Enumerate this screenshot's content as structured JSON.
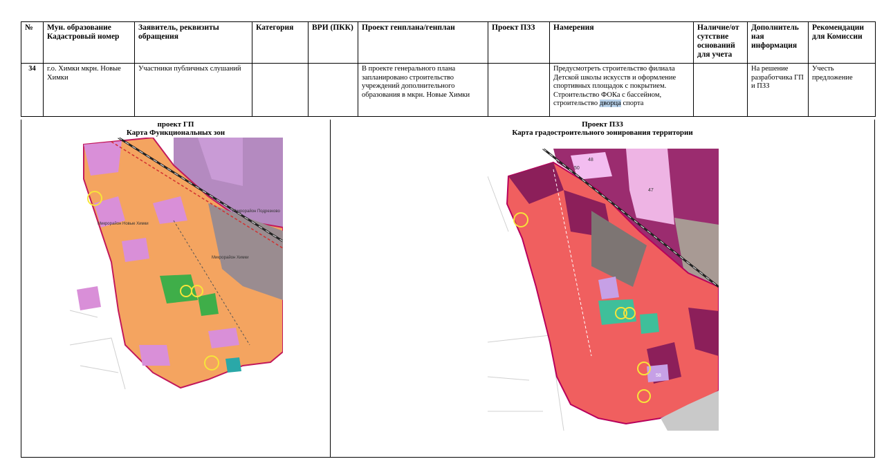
{
  "table": {
    "headers": [
      "№",
      "Мун. образование Кадастровый номер",
      "Заявитель, реквизиты обращения",
      "Категория",
      "ВРИ (ПКК)",
      "Проект генплана/генплан",
      "Проект ПЗЗ",
      "Намерения",
      "Наличие/от сутствие оснований для учета",
      "Дополнитель ная информация",
      "Рекомендации для Комиссии"
    ],
    "row": {
      "num": "34",
      "municipality": "г.о. Химки мкрн. Новые Химки",
      "applicant": "Участники публичных слушаний",
      "category": "",
      "vri": "",
      "genplan": "В проекте генерального плана запланировано строительство учреждений дополнительного образования в мкрн. Новые Химки",
      "pzz": "",
      "intentions_main": "Предусмотреть строительство филиала Детской школы искусств и оформление спортивных площадок с покрытием. Строительство ФОКа с бассейном, строительство ",
      "intentions_highlight": "дворца",
      "intentions_tail": " спорта",
      "grounds": "",
      "additional": "На решение разработчика ГП и ПЗЗ",
      "recommendation": "Учесть предложение"
    }
  },
  "maps": {
    "left": {
      "caption_line1": "проект ГП",
      "caption_line2": "Карта Функциональных зон",
      "labels": [
        "Микрорайон Новые Химки",
        "Микрорайон Подрезково",
        "Микрорайон Химки"
      ]
    },
    "right": {
      "caption_line1": "Проект ПЗЗ",
      "caption_line2": "Карта градостроительного зонирования территории",
      "labels": [
        "48",
        "50",
        "47",
        "58"
      ]
    }
  },
  "colors": {
    "residential": "#f4a460",
    "public": "#d98fd8",
    "industrial": "#a07aa8",
    "green": "#3fae49",
    "zone_red": "#f05f5f",
    "zone_purple": "#8c1f5a",
    "highlight_ring": "#f7e43a"
  }
}
